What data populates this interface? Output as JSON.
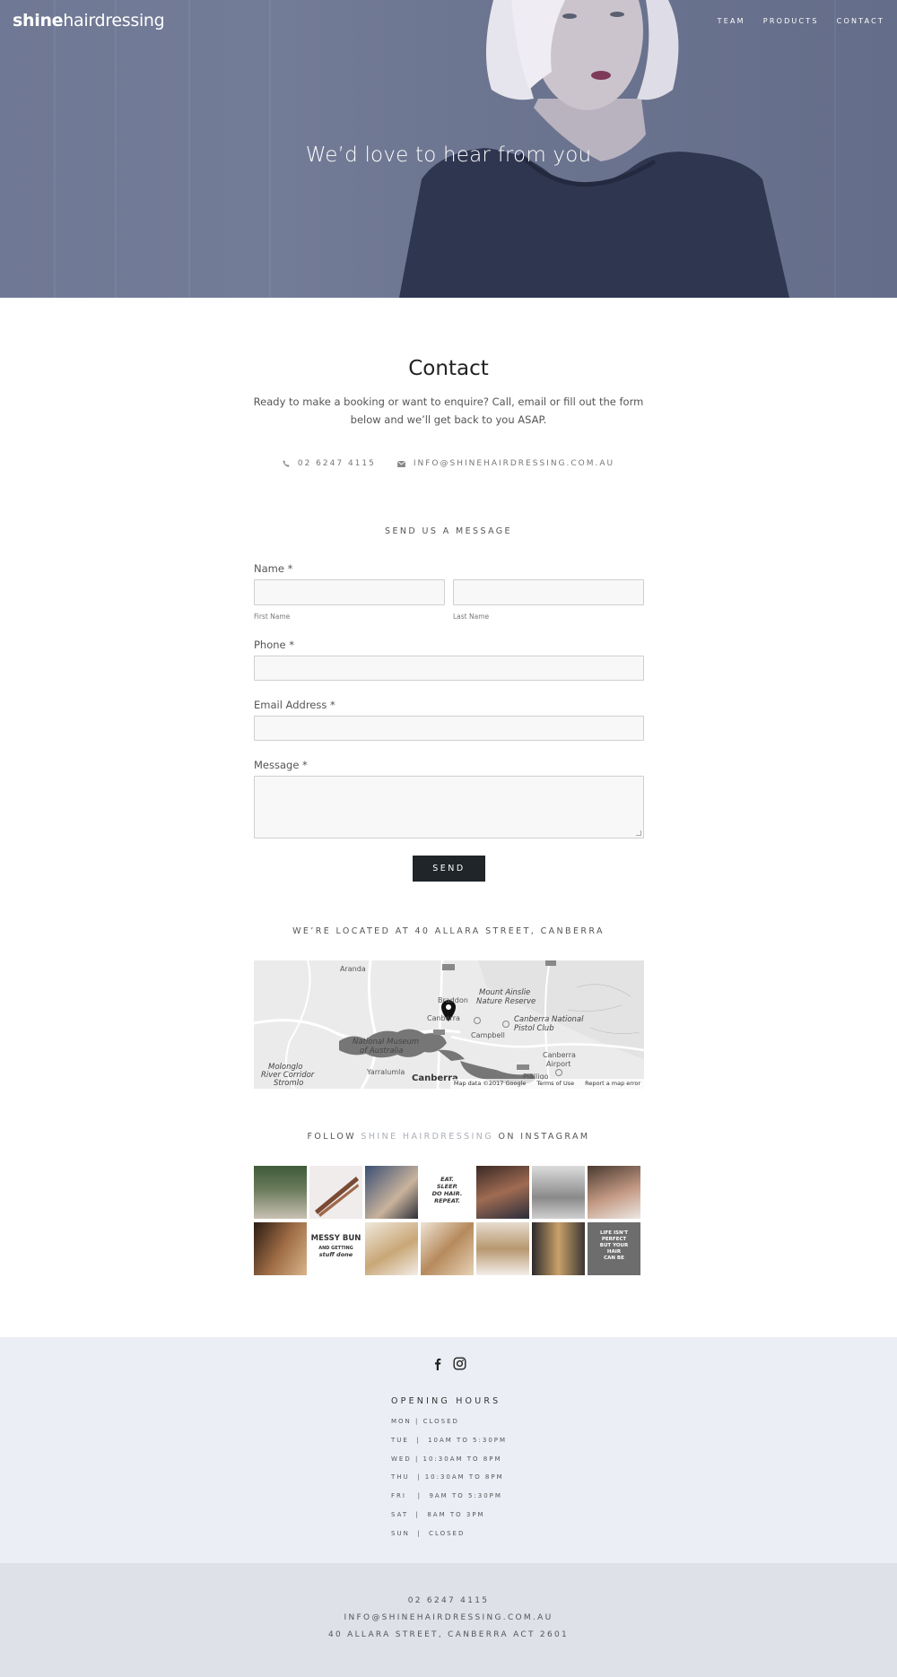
{
  "brand": {
    "bold": "shine",
    "regular": "hairdressing"
  },
  "nav": [
    "TEAM",
    "PRODUCTS",
    "CONTACT"
  ],
  "hero": {
    "title": "We’d love to hear from you"
  },
  "contact": {
    "title": "Contact",
    "intro": "Ready to make a booking or want to enquire? Call, email or fill out the form below and we’ll get back to you ASAP.",
    "phone": "02 6247 4115",
    "email": "INFO@SHINEHAIRDRESSING.COM.AU"
  },
  "form": {
    "heading": "SEND US A MESSAGE",
    "name_label": "Name *",
    "first_name_label": "First Name",
    "last_name_label": "Last Name",
    "phone_label": "Phone *",
    "email_label": "Email Address *",
    "message_label": "Message *",
    "send_label": "SEND"
  },
  "location": {
    "heading": "WE’RE LOCATED AT 40 ALLARA STREET, CANBERRA",
    "map": {
      "labels": [
        "Aranda",
        "Mount Ainslie",
        "Nature Reserve",
        "Braddon",
        "Canberra",
        "Campbell",
        "Canberra National",
        "Pistol Club",
        "National Museum",
        "of Australia",
        "Canberra",
        "Airport",
        "Molonglo",
        "River Corridor",
        "Stromlo",
        "Yarralumla",
        "Canberra",
        "Pialligo"
      ],
      "road_shields": [
        "A23",
        "A23",
        "A23"
      ],
      "attribution": [
        "Map data ©2017 Google",
        "Terms of Use",
        "Report a map error"
      ]
    }
  },
  "instagram": {
    "prefix": "FOLLOW ",
    "handle": "SHINE HAIRDRESSING",
    "suffix": " ON INSTAGRAM",
    "tile_text": {
      "eat_sleep": [
        "EAT.",
        "SLEEP.",
        "DO HAIR.",
        "REPEAT."
      ],
      "messy_bun": [
        "MESSY BUN",
        "AND GETTING",
        "stuff done"
      ],
      "life_quote": [
        "LIFE ISN'T",
        "PERFECT",
        "BUT YOUR",
        "HAIR",
        "CAN BE"
      ]
    }
  },
  "hours": {
    "title": "OPENING HOURS",
    "rows": [
      "MON | CLOSED",
      "TUE  |  10AM TO 5:30PM",
      "WED | 10:30AM TO 8PM",
      "THU  | 10:30AM TO 8PM",
      "FRI   |  9AM TO 5:30PM",
      "SAT  |  8AM TO 3PM",
      "SUN  |  CLOSED"
    ]
  },
  "footer": {
    "phone": "02 6247 4115",
    "email": "INFO@SHINEHAIRDRESSING.COM.AU",
    "address": "40 ALLARA STREET, CANBERRA ACT 2601"
  },
  "icons": [
    "phone-icon",
    "envelope-icon",
    "map-pin-icon",
    "facebook-icon",
    "instagram-icon"
  ]
}
